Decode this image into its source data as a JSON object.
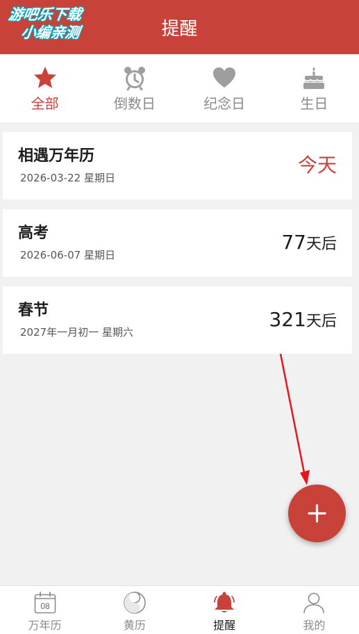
{
  "watermark": {
    "line1": "游吧乐下载",
    "line2": "小编亲测"
  },
  "header": {
    "title": "提醒"
  },
  "tabs": [
    {
      "label": "全部",
      "icon": "star-icon",
      "active": true
    },
    {
      "label": "倒数日",
      "icon": "alarm-clock-icon",
      "active": false
    },
    {
      "label": "纪念日",
      "icon": "heart-icon",
      "active": false
    },
    {
      "label": "生日",
      "icon": "birthday-cake-icon",
      "active": false
    }
  ],
  "reminders": [
    {
      "title": "相遇万年历",
      "date": "2026-03-22 星期日",
      "status": "今天"
    },
    {
      "title": "高考",
      "date": "2026-06-07 星期日",
      "days": "77",
      "suffix": "天后"
    },
    {
      "title": "春节",
      "date": "2027年一月初一 星期六",
      "days": "321",
      "suffix": "天后"
    }
  ],
  "fab": {
    "icon": "plus-icon"
  },
  "bottom_nav": [
    {
      "label": "万年历",
      "icon": "calendar-icon",
      "calendar_day": "08",
      "active": false
    },
    {
      "label": "黄历",
      "icon": "yin-yang-icon",
      "active": false
    },
    {
      "label": "提醒",
      "icon": "bell-icon",
      "active": true
    },
    {
      "label": "我的",
      "icon": "user-icon",
      "active": false
    }
  ],
  "colors": {
    "accent": "#c9423a",
    "inactive": "#8a8a8a",
    "background": "#f1f1f1",
    "annotation_arrow": "#e8141e"
  }
}
